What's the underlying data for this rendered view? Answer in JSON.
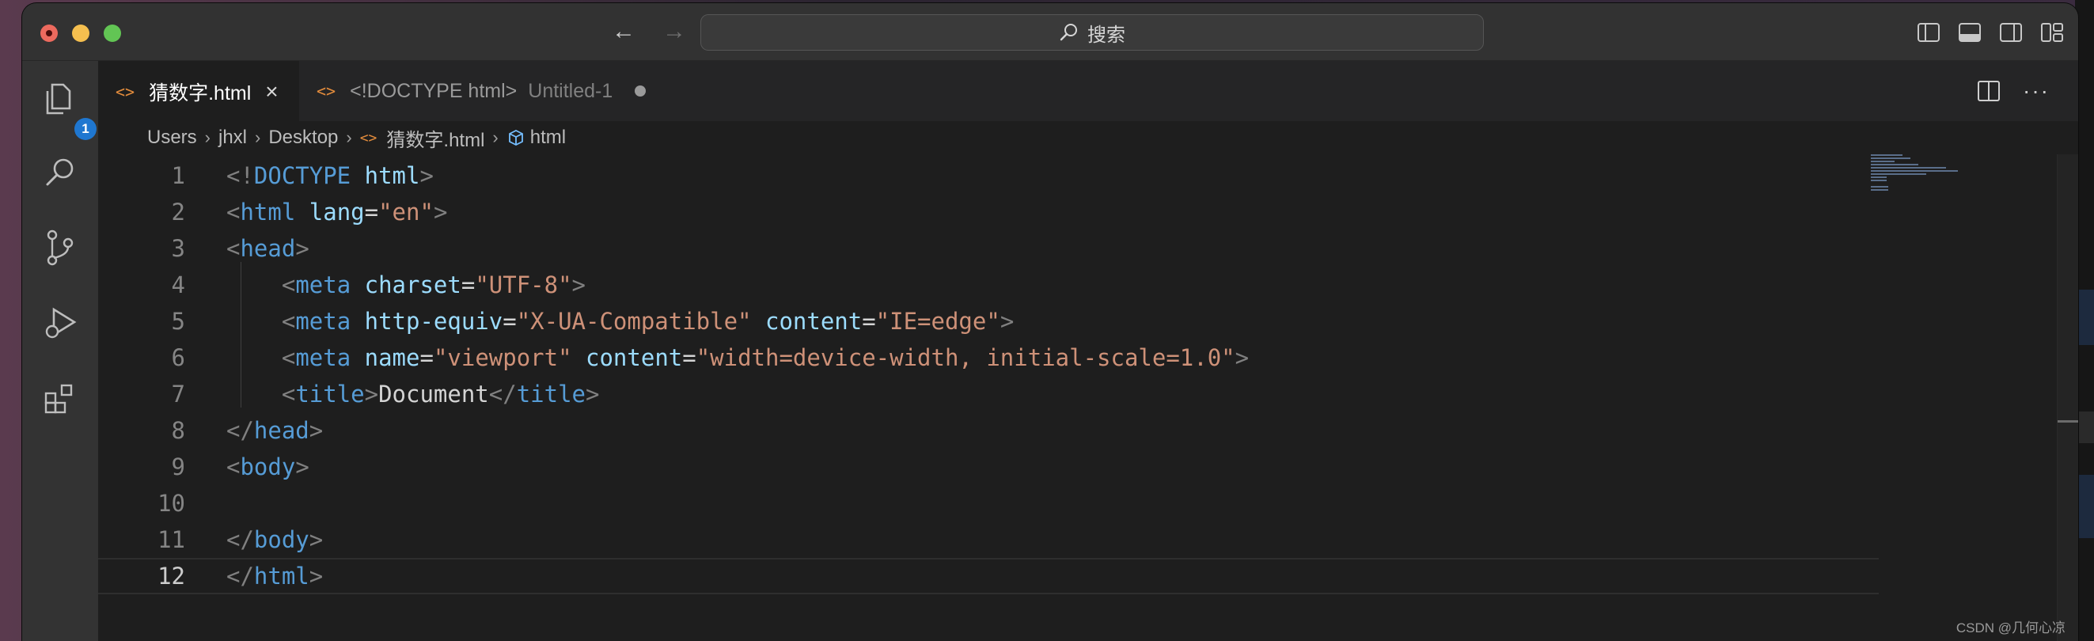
{
  "titlebar": {
    "search_placeholder": "搜索"
  },
  "activity_bar": {
    "explorer_badge": "1"
  },
  "tabs": [
    {
      "label": "猜数字.html",
      "active": true
    },
    {
      "label": "<!DOCTYPE html>",
      "subtitle": "Untitled-1",
      "active": false,
      "dirty": true
    }
  ],
  "breadcrumb": [
    "Users",
    "jhxl",
    "Desktop",
    "猜数字.html",
    "html"
  ],
  "editor": {
    "lines": [
      {
        "n": "1",
        "tokens": [
          [
            "punct",
            "<!"
          ],
          [
            "tag",
            "DOCTYPE"
          ],
          [
            "txt",
            " "
          ],
          [
            "attr",
            "html"
          ],
          [
            "punct",
            ">"
          ]
        ]
      },
      {
        "n": "2",
        "tokens": [
          [
            "punct",
            "<"
          ],
          [
            "tag",
            "html"
          ],
          [
            "txt",
            " "
          ],
          [
            "attr",
            "lang"
          ],
          [
            "txt",
            "="
          ],
          [
            "str",
            "\"en\""
          ],
          [
            "punct",
            ">"
          ]
        ]
      },
      {
        "n": "3",
        "tokens": [
          [
            "punct",
            "<"
          ],
          [
            "tag",
            "head"
          ],
          [
            "punct",
            ">"
          ]
        ]
      },
      {
        "n": "4",
        "tokens": [
          [
            "txt",
            "    "
          ],
          [
            "punct",
            "<"
          ],
          [
            "tag",
            "meta"
          ],
          [
            "txt",
            " "
          ],
          [
            "attr",
            "charset"
          ],
          [
            "txt",
            "="
          ],
          [
            "str",
            "\"UTF-8\""
          ],
          [
            "punct",
            ">"
          ]
        ]
      },
      {
        "n": "5",
        "tokens": [
          [
            "txt",
            "    "
          ],
          [
            "punct",
            "<"
          ],
          [
            "tag",
            "meta"
          ],
          [
            "txt",
            " "
          ],
          [
            "attr",
            "http-equiv"
          ],
          [
            "txt",
            "="
          ],
          [
            "str",
            "\"X-UA-Compatible\""
          ],
          [
            "txt",
            " "
          ],
          [
            "attr",
            "content"
          ],
          [
            "txt",
            "="
          ],
          [
            "str",
            "\"IE=edge\""
          ],
          [
            "punct",
            ">"
          ]
        ]
      },
      {
        "n": "6",
        "tokens": [
          [
            "txt",
            "    "
          ],
          [
            "punct",
            "<"
          ],
          [
            "tag",
            "meta"
          ],
          [
            "txt",
            " "
          ],
          [
            "attr",
            "name"
          ],
          [
            "txt",
            "="
          ],
          [
            "str",
            "\"viewport\""
          ],
          [
            "txt",
            " "
          ],
          [
            "attr",
            "content"
          ],
          [
            "txt",
            "="
          ],
          [
            "str",
            "\"width=device-width, initial-scale=1.0\""
          ],
          [
            "punct",
            ">"
          ]
        ]
      },
      {
        "n": "7",
        "tokens": [
          [
            "txt",
            "    "
          ],
          [
            "punct",
            "<"
          ],
          [
            "tag",
            "title"
          ],
          [
            "punct",
            ">"
          ],
          [
            "txt",
            "Document"
          ],
          [
            "punct",
            "</"
          ],
          [
            "tag",
            "title"
          ],
          [
            "punct",
            ">"
          ]
        ]
      },
      {
        "n": "8",
        "tokens": [
          [
            "punct",
            "</"
          ],
          [
            "tag",
            "head"
          ],
          [
            "punct",
            ">"
          ]
        ]
      },
      {
        "n": "9",
        "tokens": [
          [
            "punct",
            "<"
          ],
          [
            "tag",
            "body"
          ],
          [
            "punct",
            ">"
          ]
        ]
      },
      {
        "n": "10",
        "tokens": []
      },
      {
        "n": "11",
        "tokens": [
          [
            "punct",
            "</"
          ],
          [
            "tag",
            "body"
          ],
          [
            "punct",
            ">"
          ]
        ]
      },
      {
        "n": "12",
        "tokens": [
          [
            "punct",
            "</"
          ],
          [
            "tag",
            "html"
          ],
          [
            "punct",
            ">"
          ]
        ],
        "current": true
      }
    ]
  },
  "watermark": "CSDN @几何心凉",
  "colors": {
    "tag": "#569cd6",
    "attr": "#9cdcfe",
    "string": "#ce9178",
    "punct": "#808080",
    "file_icon": "#e38c3c",
    "badge": "#1f77d0"
  }
}
